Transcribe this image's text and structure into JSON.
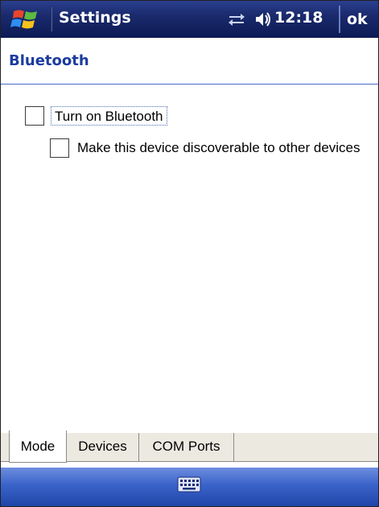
{
  "titlebar": {
    "app_title": "Settings",
    "clock": "12:18",
    "ok_label": "ok",
    "icons": [
      "windows-start-icon",
      "connectivity-icon",
      "speaker-icon"
    ]
  },
  "page": {
    "title": "Bluetooth"
  },
  "options": {
    "turn_on_label": "Turn on Bluetooth",
    "turn_on_checked": false,
    "discoverable_label": "Make this device discoverable to other devices",
    "discoverable_checked": false
  },
  "tabs": [
    {
      "label": "Mode",
      "selected": true
    },
    {
      "label": "Devices",
      "selected": false
    },
    {
      "label": "COM Ports",
      "selected": false
    }
  ],
  "menubar": {
    "icon": "keyboard-icon"
  },
  "colors": {
    "title_bar": "#1a2a6c",
    "heading_blue": "#1b3c9e",
    "menubar_blue": "#3a63c9"
  }
}
